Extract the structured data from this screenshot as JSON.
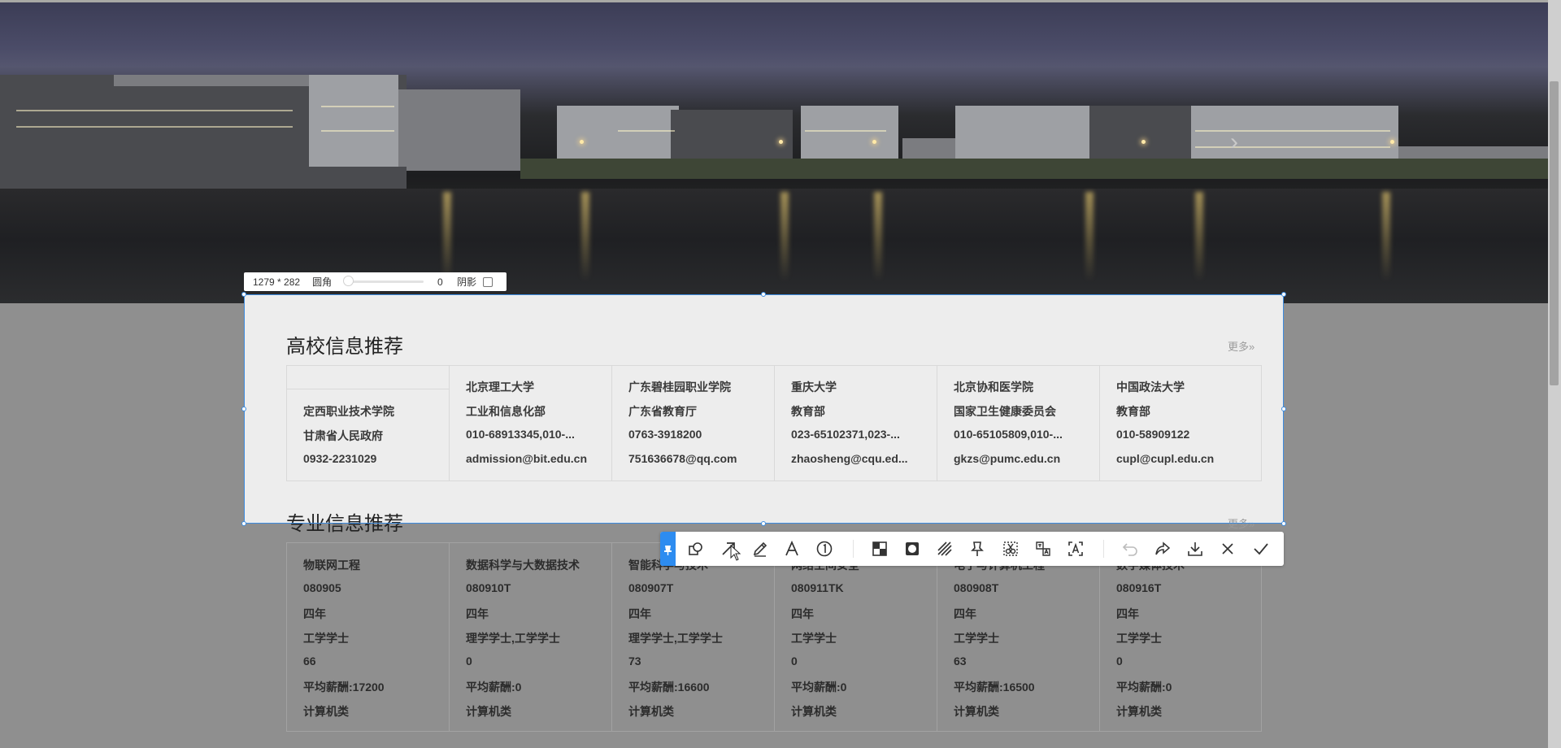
{
  "capture": {
    "size_label": "1279 * 282",
    "radius_label": "圆角",
    "radius_value": "0",
    "shadow_label": "阴影"
  },
  "colleges": {
    "title": "高校信息推荐",
    "more": "更多»",
    "items": [
      {
        "name": "定西职业技术学院",
        "dept": "甘肃省人民政府",
        "phone": "0932-2231029",
        "email": ""
      },
      {
        "name": "北京理工大学",
        "dept": "工业和信息化部",
        "phone": "010-68913345,010-...",
        "email": "admission@bit.edu.cn"
      },
      {
        "name": "广东碧桂园职业学院",
        "dept": "广东省教育厅",
        "phone": "0763-3918200",
        "email": "751636678@qq.com"
      },
      {
        "name": "重庆大学",
        "dept": "教育部",
        "phone": "023-65102371,023-...",
        "email": "zhaosheng@cqu.ed..."
      },
      {
        "name": "北京协和医学院",
        "dept": "国家卫生健康委员会",
        "phone": "010-65105809,010-...",
        "email": "gkzs@pumc.edu.cn"
      },
      {
        "name": "中国政法大学",
        "dept": "教育部",
        "phone": "010-58909122",
        "email": "cupl@cupl.edu.cn"
      }
    ]
  },
  "majors": {
    "title": "专业信息推荐",
    "more": "更多»",
    "items": [
      {
        "name": "物联网工程",
        "code": "080905",
        "years": "四年",
        "degree": "工学学士",
        "num": "66",
        "salary": "平均薪酬:17200",
        "category": "计算机类"
      },
      {
        "name": "数据科学与大数据技术",
        "code": "080910T",
        "years": "四年",
        "degree": "理学学士,工学学士",
        "num": "0",
        "salary": "平均薪酬:0",
        "category": "计算机类"
      },
      {
        "name": "智能科学与技术",
        "code": "080907T",
        "years": "四年",
        "degree": "理学学士,工学学士",
        "num": "73",
        "salary": "平均薪酬:16600",
        "category": "计算机类"
      },
      {
        "name": "网络空间安全",
        "code": "080911TK",
        "years": "四年",
        "degree": "工学学士",
        "num": "0",
        "salary": "平均薪酬:0",
        "category": "计算机类"
      },
      {
        "name": "电子与计算机工程",
        "code": "080908T",
        "years": "四年",
        "degree": "工学学士",
        "num": "63",
        "salary": "平均薪酬:16500",
        "category": "计算机类"
      },
      {
        "name": "数字媒体技术",
        "code": "080916T",
        "years": "四年",
        "degree": "工学学士",
        "num": "0",
        "salary": "平均薪酬:0",
        "category": "计算机类"
      }
    ]
  },
  "toolbar_tools": [
    "shape-tool",
    "arrow-tool",
    "pen-tool",
    "text-tool",
    "number-tool",
    "mosaic-tool",
    "blur-tool",
    "hatch-tool",
    "pin-tool",
    "cut-tool",
    "translate-tool",
    "ocr-tool",
    "undo",
    "redo",
    "download",
    "cancel",
    "confirm"
  ],
  "colors": {
    "accent": "#3d8ce0",
    "flag": "#2d8cf0"
  }
}
